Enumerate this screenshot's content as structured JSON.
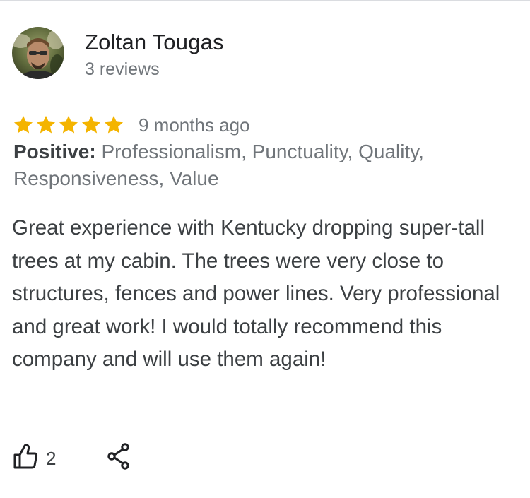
{
  "review": {
    "author": {
      "name": "Zoltan Tougas",
      "meta": "3 reviews"
    },
    "rating": {
      "stars": 5,
      "max": 5,
      "date": "9 months ago"
    },
    "attributes": {
      "label": "Positive:",
      "values": "Professionalism, Punctuality, Quality, Responsiveness, Value"
    },
    "text": "Great experience with Kentucky dropping super-tall trees at my cabin. The trees were very close to structures, fences and power lines. Very professional and great work! I would totally recommend this company and will use them again!",
    "actions": {
      "like_count": "2",
      "like_icon": "thumb-up-icon",
      "share_icon": "share-icon"
    }
  },
  "colors": {
    "star": "#f4b400",
    "text_primary": "#202124",
    "text_secondary": "#70757a",
    "body_text": "#3c4043",
    "divider": "#dadce0"
  }
}
